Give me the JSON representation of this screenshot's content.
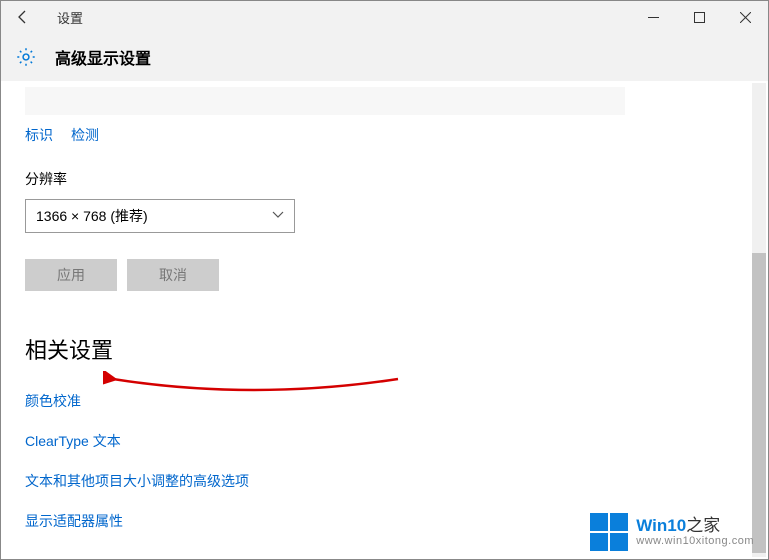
{
  "titlebar": {
    "title": "设置"
  },
  "header": {
    "heading": "高级显示设置"
  },
  "links": {
    "identify": "标识",
    "detect": "检测"
  },
  "resolution": {
    "label": "分辨率",
    "value": "1366 × 768 (推荐)"
  },
  "buttons": {
    "apply": "应用",
    "cancel": "取消"
  },
  "related": {
    "title": "相关设置",
    "color_calibration": "颜色校准",
    "cleartype": "ClearType 文本",
    "text_scaling": "文本和其他项目大小调整的高级选项",
    "adapter_props": "显示适配器属性"
  },
  "watermark": {
    "brand_prefix": "Win10",
    "brand_suffix": "之家",
    "url": "www.win10xitong.com"
  }
}
